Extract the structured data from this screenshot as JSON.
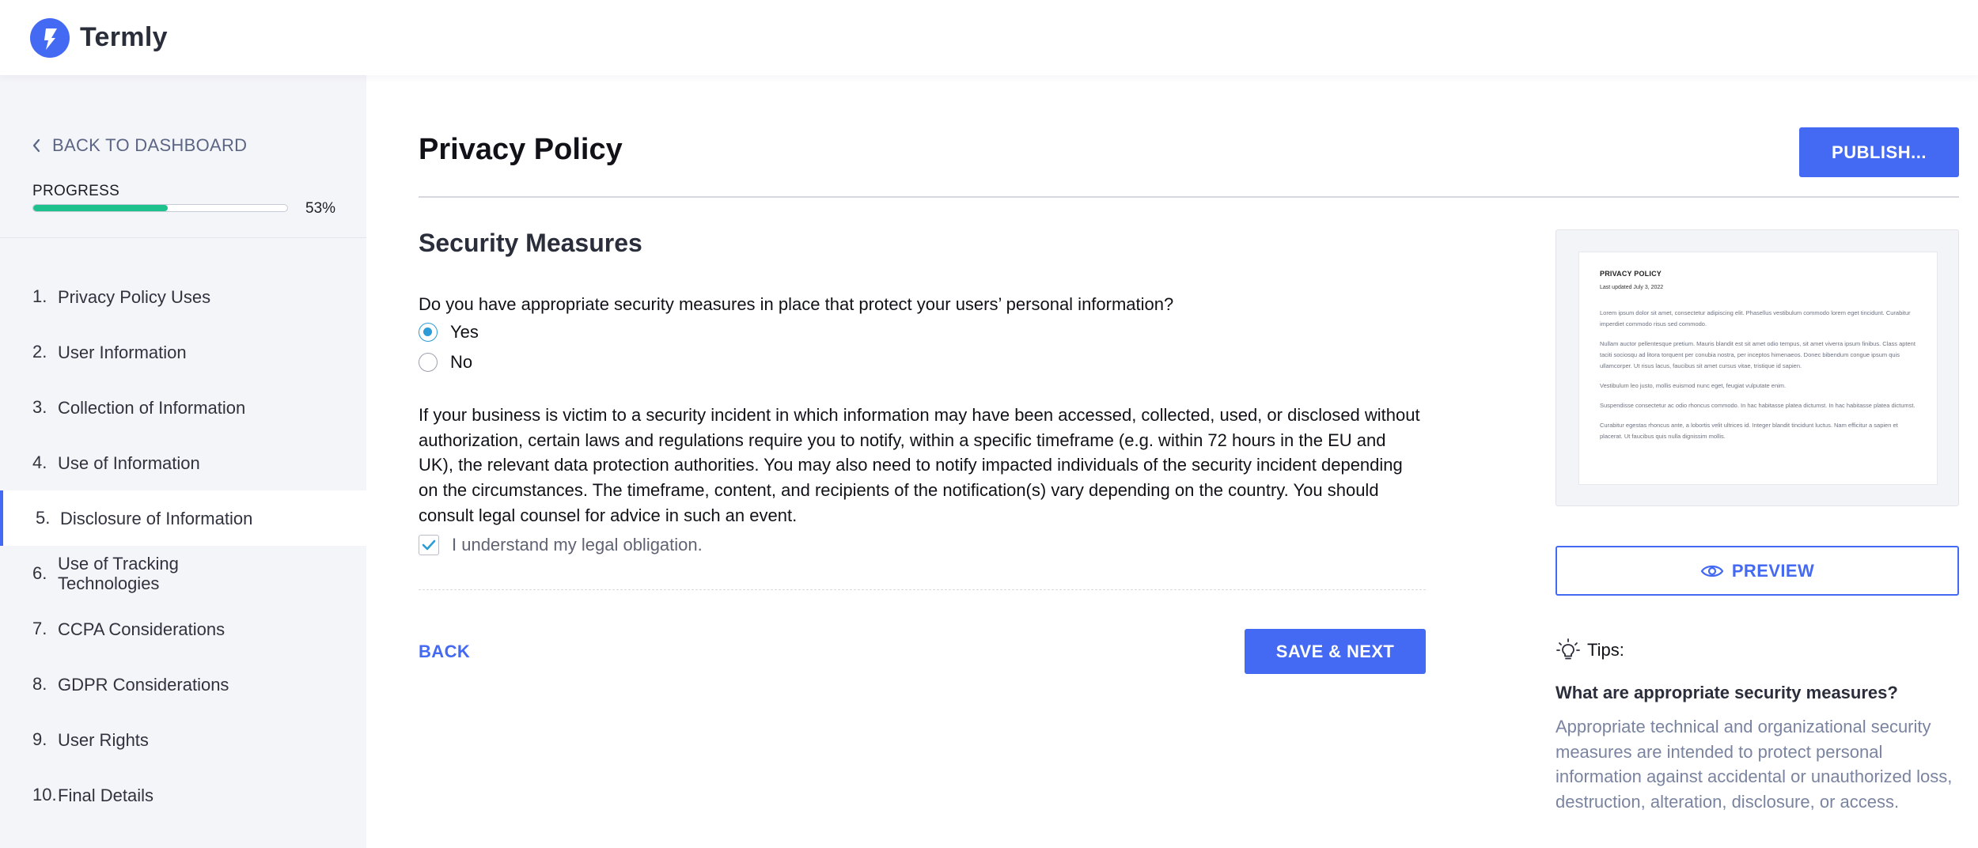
{
  "app": {
    "name": "Termly"
  },
  "sidebar": {
    "back_label": "BACK TO DASHBOARD",
    "progress": {
      "label": "PROGRESS",
      "value": 53,
      "text": "53%"
    },
    "items": [
      {
        "num": "1.",
        "label": "Privacy Policy Uses"
      },
      {
        "num": "2.",
        "label": "User Information"
      },
      {
        "num": "3.",
        "label": "Collection of Information"
      },
      {
        "num": "4.",
        "label": "Use of Information"
      },
      {
        "num": "5.",
        "label": "Disclosure of Information",
        "active": true
      },
      {
        "num": "6.",
        "label": "Use of Tracking Technologies"
      },
      {
        "num": "7.",
        "label": "CCPA Considerations"
      },
      {
        "num": "8.",
        "label": "GDPR Considerations"
      },
      {
        "num": "9.",
        "label": "User Rights"
      },
      {
        "num": "10.",
        "label": "Final Details"
      }
    ]
  },
  "header": {
    "title": "Privacy Policy",
    "publish_label": "PUBLISH..."
  },
  "section": {
    "title": "Security Measures",
    "question": "Do you have appropriate security measures in place that protect your users’ personal information?",
    "options": [
      {
        "label": "Yes",
        "selected": true
      },
      {
        "label": "No",
        "selected": false
      }
    ],
    "paragraph": "If your business is victim to a security incident in which information may have been accessed, collected, used, or disclosed without authorization, certain laws and regulations require you to notify, within a specific timeframe (e.g. within 72 hours in the EU and UK), the relevant data protection authorities. You may also need to notify impacted individuals of the security incident depending on the circumstances. The timeframe, content, and recipients of the notification(s) vary depending on the country. You should consult legal counsel for advice in such an event.",
    "acknowledge_label": "I understand my legal obligation.",
    "acknowledge_checked": true,
    "back_label": "BACK",
    "save_label": "SAVE & NEXT"
  },
  "preview_doc": {
    "title": "PRIVACY POLICY",
    "date": "Last updated July 3, 2022",
    "paragraphs": [
      "Lorem ipsum dolor sit amet, consectetur adipiscing elit. Phasellus vestibulum commodo lorem eget tincidunt. Curabitur imperdiet commodo risus sed commodo.",
      "Nullam auctor pellentesque pretium. Mauris blandit est sit amet odio tempus, sit amet viverra ipsum finibus. Class aptent taciti sociosqu ad litora torquent per conubia nostra, per inceptos himenaeos. Donec bibendum congue ipsum quis ullamcorper. Ut risus lacus, faucibus sit amet cursus vitae, tristique id sapien.",
      "Vestibulum leo justo, mollis euismod nunc eget, feugiat vulputate enim.",
      "Suspendisse consectetur ac odio rhoncus commodo. In hac habitasse platea dictumst. In hac habitasse platea dictumst.",
      "Curabitur egestas rhoncus ante, a lobortis velit ultrices id. Integer blandit tincidunt luctus. Nam efficitur a sapien et placerat. Ut faucibus quis nulla dignissim mollis."
    ]
  },
  "preview_button": {
    "label": "PREVIEW"
  },
  "tips": {
    "heading": "Tips:",
    "question": "What are appropriate security measures?",
    "answer": "Appropriate technical and organizational security measures are intended to protect personal information against accidental or unauthorized loss, destruction, alteration, disclosure, or access."
  },
  "colors": {
    "accent": "#4469f3",
    "progress": "#1ec18d",
    "radio": "#2d9bd6"
  },
  "icons": {
    "logo": "termly-logo-icon",
    "back": "chevron-left-icon",
    "preview": "eye-icon",
    "tips": "lightbulb-icon",
    "check": "checkmark-icon"
  }
}
